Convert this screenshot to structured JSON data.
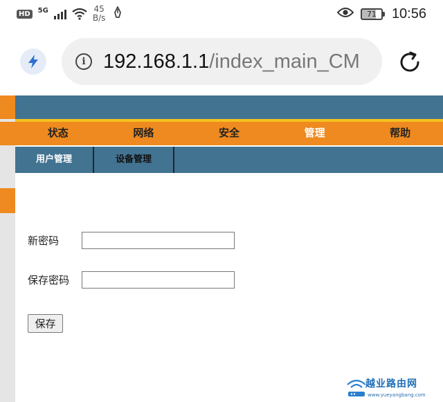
{
  "status_bar": {
    "hd": "HD",
    "network": "5G",
    "speed_value": "45",
    "speed_unit": "B/s",
    "battery": "71",
    "time": "10:56"
  },
  "browser": {
    "url_host": "192.168.1.1",
    "url_path": "/index_main_CM",
    "info_icon_glyph": "i"
  },
  "router": {
    "main_nav": [
      "状态",
      "网络",
      "安全",
      "管理",
      "帮助"
    ],
    "active_main": "管理",
    "sub_nav": [
      "用户管理",
      "设备管理"
    ],
    "active_sub": "用户管理",
    "form": {
      "new_password_label": "新密码",
      "confirm_password_label": "保存密码",
      "new_password_value": "",
      "confirm_password_value": "",
      "save_label": "保存"
    },
    "colors": {
      "header_blue": "#427391",
      "nav_orange": "#ee8a1f",
      "stripe_yellow": "#f4c21e"
    }
  },
  "watermark": {
    "brand": "越业路由网",
    "url": "www.yueyangbang.com"
  }
}
